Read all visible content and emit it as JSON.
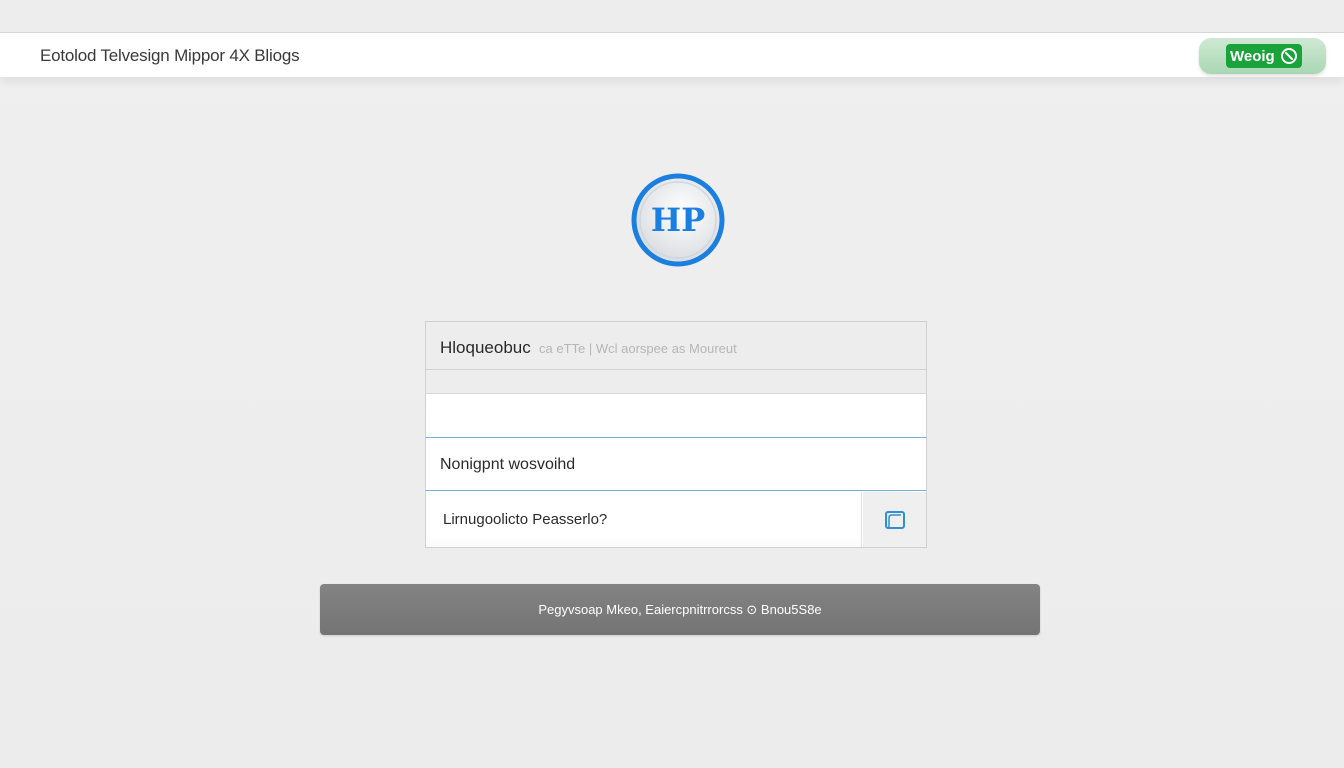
{
  "header": {
    "title": "Eotolod Telvesign Mippor 4X Bliogs",
    "badge_label": "Weoig",
    "badge_icon": "refresh-icon"
  },
  "logo": {
    "text": "HP",
    "accent_color": "#1a7fe0"
  },
  "form": {
    "heading": "Hloqueobuc",
    "heading_faint": "ca eTTe | Wcl aorspee as Moureut",
    "new_password_placeholder": "Nonigpnt wosvoihd",
    "confirm_password_placeholder": "Lirnugoolicto Peasserlo?",
    "show_password_icon": "square-outline-icon"
  },
  "submit": {
    "label": "Pegyvsoap Mkeo, Eaiercpnitrrorcss  ⊙ Bnou5S8e"
  },
  "colors": {
    "accent": "#1a7fe0",
    "badge_green": "#19a33a",
    "button_gray": "#7b7b7b"
  }
}
